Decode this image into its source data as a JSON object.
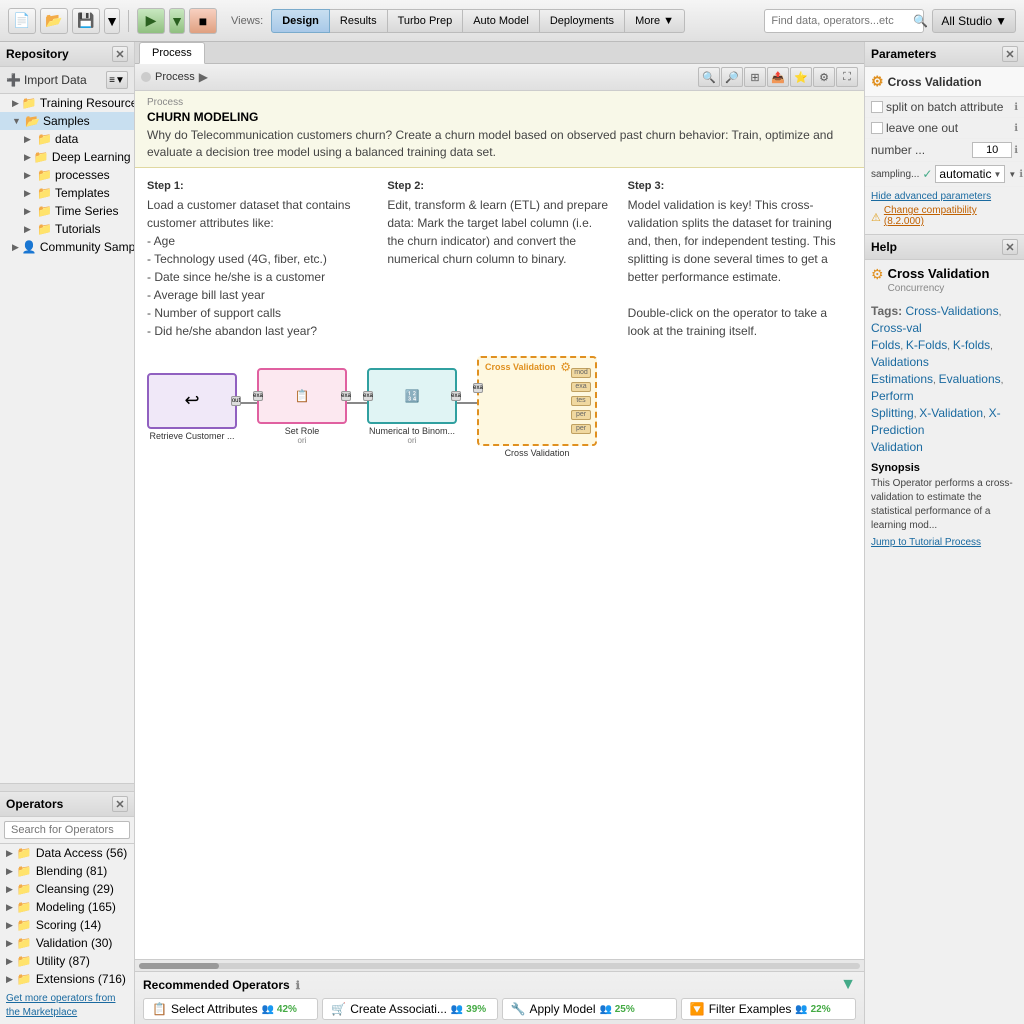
{
  "toolbar": {
    "views_label": "Views:",
    "view_buttons": [
      "Design",
      "Results",
      "Turbo Prep",
      "Auto Model",
      "Deployments",
      "More ▼"
    ],
    "active_view": "Design",
    "search_placeholder": "Find data, operators...etc",
    "studio_label": "All Studio"
  },
  "repository": {
    "title": "Repository",
    "import_label": "Import Data",
    "tree_items": [
      {
        "label": "Training Resources",
        "level": 1,
        "type": "folder-collapsed"
      },
      {
        "label": "Samples",
        "level": 1,
        "type": "folder-open",
        "selected": true
      },
      {
        "label": "data",
        "level": 2,
        "type": "folder"
      },
      {
        "label": "Deep Learning",
        "level": 2,
        "type": "folder"
      },
      {
        "label": "processes",
        "level": 2,
        "type": "folder"
      },
      {
        "label": "Templates",
        "level": 2,
        "type": "folder"
      },
      {
        "label": "Time Series",
        "level": 2,
        "type": "folder"
      },
      {
        "label": "Tutorials",
        "level": 2,
        "type": "folder"
      },
      {
        "label": "Community Sampl...",
        "level": 1,
        "type": "folder-user"
      }
    ]
  },
  "operators": {
    "title": "Operators",
    "search_placeholder": "Search for Operators",
    "categories": [
      {
        "label": "Data Access (56)",
        "expanded": false
      },
      {
        "label": "Blending (81)",
        "expanded": false
      },
      {
        "label": "Cleansing (29)",
        "expanded": false
      },
      {
        "label": "Modeling (165)",
        "expanded": false
      },
      {
        "label": "Scoring (14)",
        "expanded": false
      },
      {
        "label": "Validation (30)",
        "expanded": false
      },
      {
        "label": "Utility (87)",
        "expanded": false
      },
      {
        "label": "Extensions (716)",
        "expanded": false
      }
    ],
    "marketplace_link": "Get more operators from the Marketplace"
  },
  "process": {
    "tab_label": "Process",
    "breadcrumb": [
      "Process",
      ""
    ],
    "title_label": "Process",
    "name": "CHURN MODELING",
    "description": "Why do Telecommunication customers churn? Create a churn model based on observed past churn behavior: Train, optimize and evaluate a decision tree model using a balanced training data set.",
    "steps": [
      {
        "label": "Step 1:",
        "text": "Load a customer dataset that contains customer attributes like:\n- Age\n- Technology used (4G, fiber, etc.)\n- Date since he/she is a customer\n- Average bill last year\n- Number of support calls\n- Did he/she abandon last year?"
      },
      {
        "label": "Step 2:",
        "text": "Edit, transform & learn (ETL) and prepare data: Mark the target label column (i.e. the churn indicator) and convert the numerical churn column to binary."
      },
      {
        "label": "Step 3:",
        "text": "Model validation is key! This cross-validation splits the dataset for training and, then, for independent testing. This splitting is done several times to get a better performance estimate.\n\nDouble-click on the operator to take a look at the training itself."
      }
    ],
    "operators": [
      {
        "label": "Retrieve Customer ...",
        "sublabel": "out",
        "type": "purple",
        "icon": "↩"
      },
      {
        "label": "Set Role",
        "sublabel": "exa ori",
        "type": "pink",
        "icon": "📋"
      },
      {
        "label": "Numerical to Binom...",
        "sublabel": "exa ori",
        "type": "teal",
        "icon": "🔢"
      },
      {
        "label": "Cross Validation",
        "sublabel": "",
        "type": "orange",
        "icon": "⚙"
      }
    ]
  },
  "recommended": {
    "title": "Recommended Operators",
    "operators": [
      {
        "label": "Select Attributes",
        "pct": "42%",
        "icon": "📋"
      },
      {
        "label": "Create Associati...",
        "pct": "39%",
        "icon": "👥"
      },
      {
        "label": "Apply Model",
        "pct": "25%",
        "icon": "🔧"
      },
      {
        "label": "Filter Examples",
        "pct": "22%",
        "icon": "🔽"
      }
    ]
  },
  "parameters": {
    "title": "Parameters",
    "operator_name": "Cross Validation",
    "params": [
      {
        "label": "split on batch attribute",
        "type": "checkbox",
        "value": false
      },
      {
        "label": "leave one out",
        "type": "checkbox",
        "value": false
      },
      {
        "label": "number ...",
        "type": "number",
        "value": "10"
      },
      {
        "label": "sampling...",
        "type": "dropdown_check",
        "value": "automatic"
      }
    ],
    "links": [
      {
        "label": "Hide advanced parameters",
        "type": "normal"
      },
      {
        "label": "Change compatibility (8.2.000)",
        "type": "warning"
      }
    ]
  },
  "help": {
    "title": "Help",
    "operator_name": "Cross Validation",
    "subtitle": "Concurrency",
    "tags_label": "Tags:",
    "tags": [
      "Cross-Validations",
      "Cross-val",
      "Folds",
      "K-Folds",
      "K-folds",
      "Validations",
      "Estimations",
      "Evaluations",
      "Perform",
      "Splitting",
      "X-Validation",
      "X-Prediction",
      "Validation"
    ],
    "synopsis_label": "Synopsis",
    "synopsis_text": "This Operator performs a cross-validation to estimate the statistical performance of a learning mod...",
    "tutorial_link": "Jump to Tutorial Process"
  }
}
